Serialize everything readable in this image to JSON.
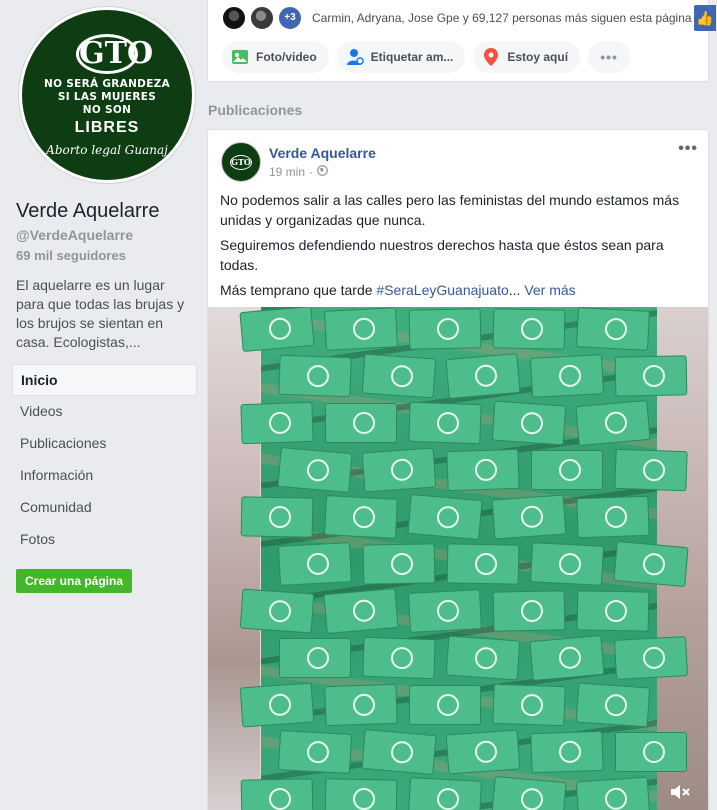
{
  "page": {
    "name": "Verde Aquelarre",
    "handle": "@VerdeAquelarre",
    "followers": "69 mil seguidores",
    "about": "El aquelarre es un lugar para que todas las brujas y los brujos se sientan en casa. Ecologistas,...",
    "logo": {
      "gto": "GTO",
      "line1": "NO SERÁ GRANDEZA",
      "line2": "SI LAS MUJERES",
      "line3": "NO SON",
      "libres": "LIBRES",
      "footer": "Aborto legal Guanaj"
    }
  },
  "nav": {
    "items": [
      "Inicio",
      "Videos",
      "Publicaciones",
      "Información",
      "Comunidad",
      "Fotos"
    ],
    "active": "Inicio"
  },
  "create_page_label": "Crear una página",
  "top_card": {
    "plus_count": "+3",
    "likes_text": "Carmin, Adryana, Jose Gpe y 69,127 personas más siguen esta página",
    "actions": {
      "photo_video": "Foto/video",
      "tag": "Etiquetar am...",
      "checkin": "Estoy aquí",
      "more": "•••"
    }
  },
  "section_title": "Publicaciones",
  "post": {
    "author": "Verde Aquelarre",
    "time": "19 min",
    "dot": "·",
    "menu": "•••",
    "paragraphs": [
      "No podemos salir a las calles pero las feministas del mundo estamos más unidas y organizadas que nunca.",
      "Seguiremos defendiendo nuestros derechos hasta que éstos sean para todas."
    ],
    "last_line_text": "Más temprano que tarde ",
    "hashtag": "#SeraLeyGuanajuato",
    "ellipsis": "...",
    "see_more": "Ver más"
  },
  "colors": {
    "link": "#365899",
    "green_button": "#42b72a",
    "logo_green": "#0e3d13",
    "bandana_green": "#4cbd8b"
  }
}
